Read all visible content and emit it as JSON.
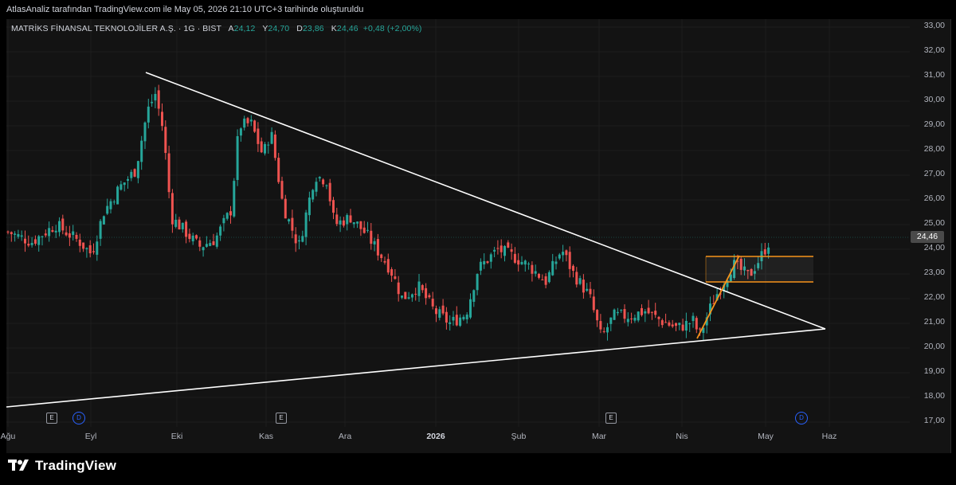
{
  "header": {
    "caption": "AtlasAnaliz tarafından TradingView.com ile May 05, 2026 21:10 UTC+3 tarihinde oluşturuldu"
  },
  "legend": {
    "symbol": "MATRİKS FİNANSAL TEKNOLOJİLER A.Ş. · 1G · BIST",
    "open_label": "A",
    "open_value": "24,12",
    "high_label": "Y",
    "high_value": "24,70",
    "low_label": "D",
    "low_value": "23,86",
    "close_label": "K",
    "close_value": "24,46",
    "change": "+0,48 (+2,00%)"
  },
  "price_axis": [
    "33,00",
    "32,00",
    "31,00",
    "30,00",
    "29,00",
    "28,00",
    "27,00",
    "26,00",
    "25,00",
    "24,00",
    "23,00",
    "22,00",
    "21,00",
    "20,00",
    "19,00",
    "18,00",
    "17,00"
  ],
  "last_price": "24,46",
  "time_axis": [
    "Ağu",
    "Eyl",
    "Eki",
    "Kas",
    "Ara",
    "2026",
    "Şub",
    "Mar",
    "Nis",
    "May",
    "Haz"
  ],
  "footer": {
    "brand": "TradingView"
  },
  "colors": {
    "up": "#26a69a",
    "down": "#ef5350",
    "trendline": "#ffffff",
    "box": "#f7931a"
  },
  "events": [
    "E",
    "D",
    "E",
    "E",
    "D"
  ]
}
